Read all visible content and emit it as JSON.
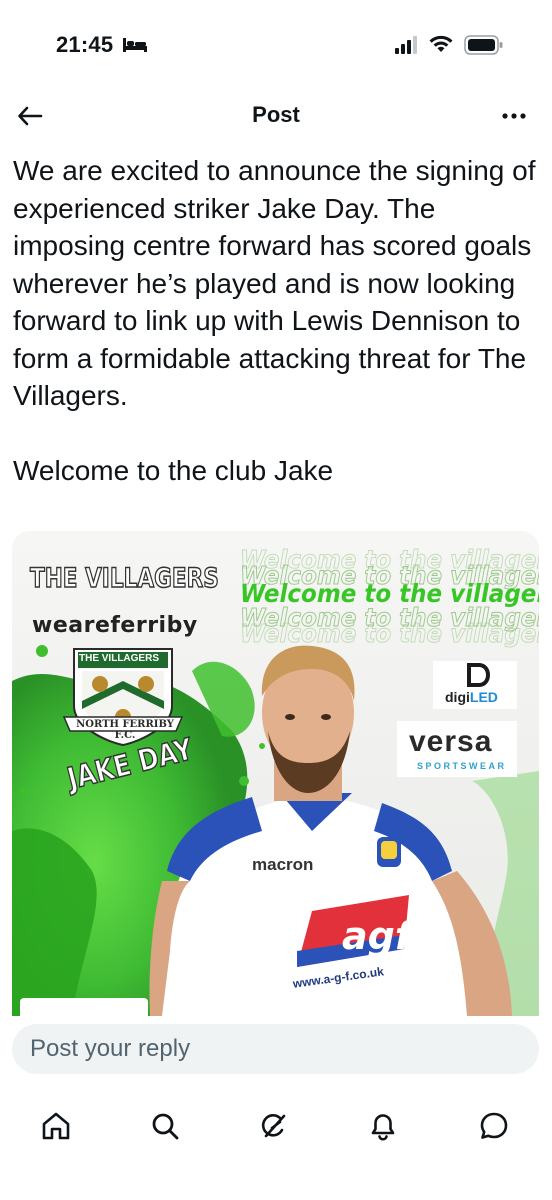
{
  "status_bar": {
    "time": "21:45",
    "icons": [
      "bed-icon",
      "cellular-signal-icon",
      "wifi-icon",
      "battery-icon"
    ]
  },
  "header": {
    "title": "Post",
    "back_icon": "arrow-left-icon",
    "more_icon": "more-horizontal-icon"
  },
  "post": {
    "paragraphs": [
      "We are excited to announce the signing of experienced striker Jake Day. The imposing centre forward has scored goals wherever he’s played and is now looking forward to link up with Lewis Dennison to form a formidable attacking threat for The Villagers.",
      "Welcome to the club Jake"
    ]
  },
  "media": {
    "title": "THE VILLAGERS",
    "hashtag": "weareferriby",
    "welcome": "Welcome to the villagers",
    "player_name": "JAKE DAY",
    "badge_top": "THE VILLAGERS",
    "badge_banner": "NORTH FERRIBY F.C.",
    "sponsor_1_prefix": "digi",
    "sponsor_1_suffix": "LED",
    "sponsor_2": "versa",
    "sponsor_2_sub": "SPORTSWEAR",
    "kit_brand": "macron",
    "shirt_sponsor": "agf",
    "shirt_url": "www.a-g-f.co.uk",
    "colors": {
      "splash_green": "#3fbf2e",
      "kit_blue": "#2a52b8",
      "sponsor_red": "#e2313a"
    }
  },
  "reply": {
    "placeholder": "Post your reply"
  },
  "tab_bar": {
    "tabs": [
      "home-icon",
      "search-icon",
      "grok-icon",
      "notifications-icon",
      "messages-icon"
    ]
  }
}
